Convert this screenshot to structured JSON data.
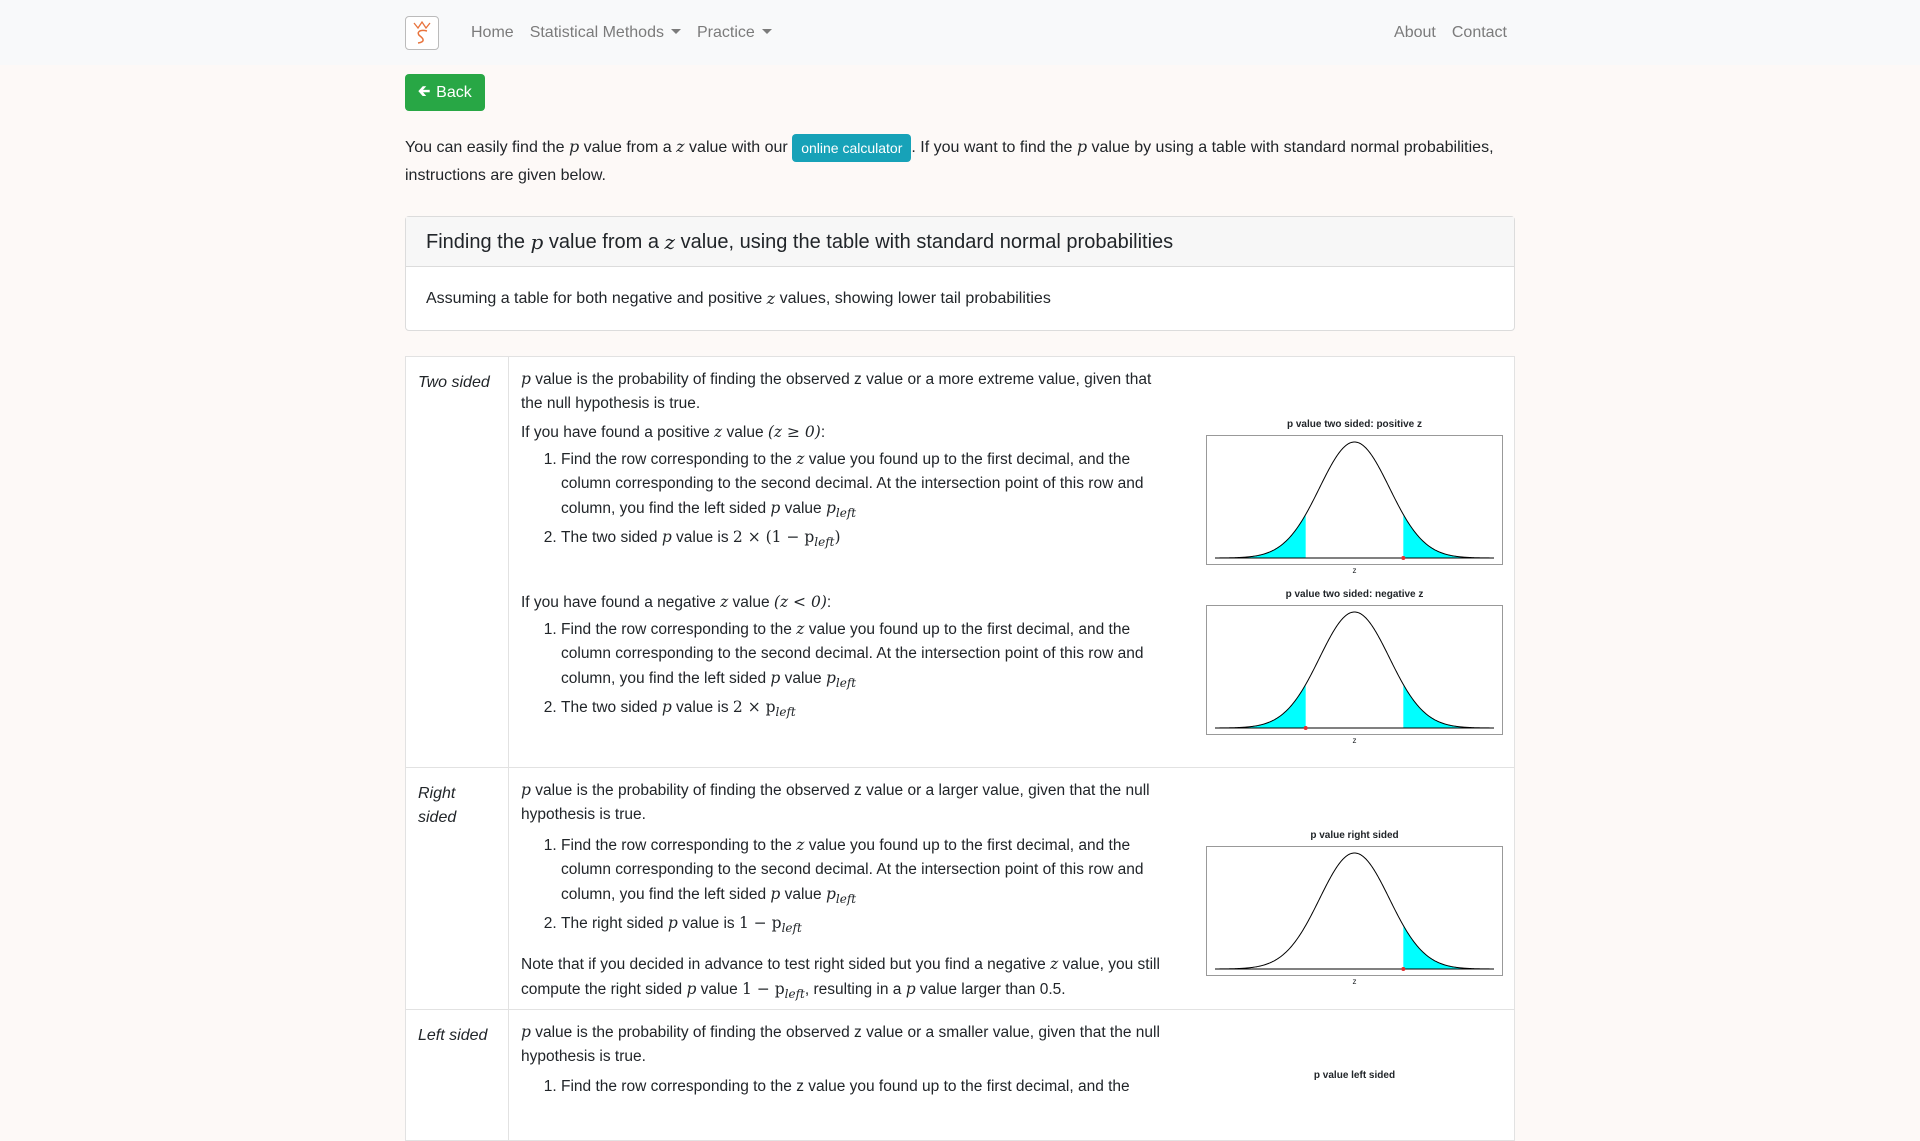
{
  "nav": {
    "home": "Home",
    "statistical_methods": "Statistical Methods",
    "practice": "Practice",
    "about": "About",
    "contact": "Contact"
  },
  "back_label": "Back",
  "intro": {
    "part1": "You can easily find the ",
    "p": "p",
    "part2": " value from a ",
    "z": "z",
    "part3": " value with our ",
    "calculator_label": "online calculator",
    "part4": ". If you want to find the ",
    "part5": " value by using a table with standard normal probabilities, instructions are given below."
  },
  "card": {
    "title_pre": "Finding the ",
    "title_mid": " value from a ",
    "title_post": " value, using the table with standard normal probabilities",
    "body_pre": "Assuming a table for both negative and positive ",
    "body_post": " values, showing lower tail probabilities"
  },
  "math": {
    "p": "p",
    "z": "z",
    "left": "left",
    "z_ge_0": "(z ≥ 0)",
    "z_lt_0": "(z < 0)",
    "two_times_one_minus": "2 × (1 − p",
    "close_paren": ")",
    "two_times": "2 × p",
    "one_minus": "1 − p"
  },
  "sections": {
    "two_sided": {
      "label": "Two sided",
      "definition": " value is the probability of finding the observed z value or a more extreme value, given that the null hypothesis is true.",
      "positive_intro": "If you have found a positive ",
      "negative_intro": "If you have found a negative ",
      "value_word": " value ",
      "step1_pre": "Find the row corresponding to the ",
      "step1_post": " value you found up to the first decimal, and the column corresponding to the second decimal. At the intersection point of this row and column, you find the left sided ",
      "step1_end": " value ",
      "step2_pre": "The two sided ",
      "step2_mid": " value is ",
      "chart_pos_title": "p value two sided: positive z",
      "chart_neg_title": "p value two sided: negative z",
      "x_axis": "z"
    },
    "right_sided": {
      "label": "Right sided",
      "definition": " value is the probability of finding the observed z value or a larger value, given that the null hypothesis is true.",
      "step2_pre": "The right sided ",
      "step2_mid": " value is ",
      "note_pre": "Note that if you decided in advance to test right sided but you find a negative ",
      "note_mid": " value, you still compute the right sided ",
      "note_mid2": " value ",
      "note_mid3": ", resulting in a ",
      "note_post": " value larger than 0.5.",
      "chart_title": "p value right sided",
      "x_axis": "z"
    },
    "left_sided": {
      "label": "Left sided",
      "definition": " value is the probability of finding the observed z value or a smaller value, given that the null hypothesis is true.",
      "step1_visible": "Find the row corresponding to the z value you found up to the first decimal, and the",
      "chart_title": "p value left sided"
    }
  },
  "colors": {
    "accent_green": "#28a745",
    "accent_teal": "#17a2b8",
    "shade_cyan": "#00ffff",
    "marker_red": "#e03030"
  }
}
